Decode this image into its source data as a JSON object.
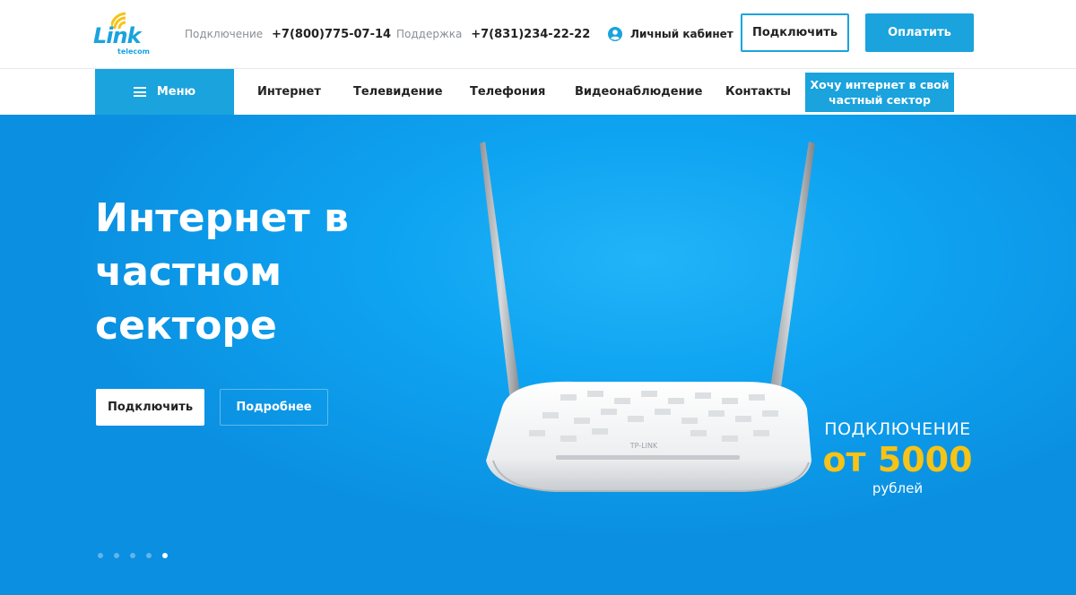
{
  "brand": {
    "logo_word": "Link",
    "logo_sub": "telecom",
    "color": "#1aa3dd",
    "wifi_color": "#f6c316"
  },
  "header": {
    "connect_label": "Подключение",
    "connect_phone": "+7(800)775-07-14",
    "support_label": "Поддержка",
    "support_phone": "+7(831)234-22-22",
    "cabinet_icon": "user-circle-icon",
    "cabinet_label": "Личный кабинет",
    "btn_connect": "Подключить",
    "btn_pay": "Оплатить"
  },
  "nav": {
    "menu_icon": "hamburger-icon",
    "menu_label": "Меню",
    "items": [
      "Интернет",
      "Телевидение",
      "Телефония",
      "Видеонаблюдение",
      "Контакты"
    ],
    "cta": "Хочу интернет в свой частный сектор"
  },
  "hero": {
    "title": "Интернет в частном секторе",
    "btn_primary": "Подключить",
    "btn_secondary": "Подробнее",
    "promo_head": "ПОДКЛЮЧЕНИЕ",
    "promo_price": "от 5000",
    "promo_unit": "рублей",
    "router_brand": "TP-LINK",
    "slides_total": 5,
    "active_slide": 5
  },
  "colors": {
    "accent": "#1aa3dd",
    "hero_bg": "#0ea3f1",
    "price": "#f6c316"
  }
}
